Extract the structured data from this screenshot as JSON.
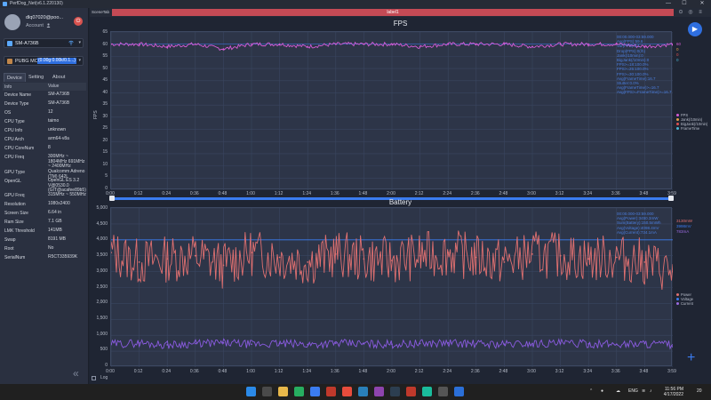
{
  "window": {
    "title": "PerfDog_Net(v6.1.220130)",
    "minimize": "—",
    "maximize": "☐",
    "close": "✕"
  },
  "account": {
    "name": "dlq07020@poo...",
    "sub": "Account",
    "sub_icon": "person-icon",
    "power": "⏻"
  },
  "device_select": {
    "label": "SM-A736B",
    "wifi": "wifi-icon",
    "chevron": "▾"
  },
  "app_select": {
    "label": "PUBG MOB...",
    "highlight": "(0.00g:0.00k/0.1...)",
    "chevron": "▾"
  },
  "tabs": [
    "Device",
    "Setting",
    "About"
  ],
  "info": {
    "header": {
      "key": "Info",
      "value": "Value"
    },
    "rows": [
      {
        "key": "Device Name",
        "value": "SM-A736B"
      },
      {
        "key": "Device Type",
        "value": "SM-A736B"
      },
      {
        "key": "OS",
        "value": "12"
      },
      {
        "key": "CPU Type",
        "value": "taimo"
      },
      {
        "key": "CPU Info",
        "value": "unknown"
      },
      {
        "key": "CPU Arch",
        "value": "arm64-v8a"
      },
      {
        "key": "CPU CoreNum",
        "value": "8"
      },
      {
        "key": "CPU Freq",
        "value": "300MHz ~ 1804MHz 691MHz ~ 2400MHz"
      },
      {
        "key": "GPU Type",
        "value": "Qualcomm Adreno (TM) 642L"
      },
      {
        "key": "OpenGL",
        "value": "OpenGL ES 3.2 V@0530.0 (GIT@acafee89b5)"
      },
      {
        "key": "GPU Freq",
        "value": "315MHz ~ 550MHz"
      },
      {
        "key": "Resolution",
        "value": "1080x2400"
      },
      {
        "key": "Screen Size",
        "value": "6.64 in"
      },
      {
        "key": "Ram Size",
        "value": "7.1 GB"
      },
      {
        "key": "LMK Threshold",
        "value": "141MB"
      },
      {
        "key": "Swap",
        "value": "8191 MB"
      },
      {
        "key": "Root",
        "value": "No"
      },
      {
        "key": "SerialNum",
        "value": "R5CT335939K"
      }
    ]
  },
  "scene": {
    "tab": "SceneTab",
    "label": "label1"
  },
  "fps_chart": {
    "title": "FPS",
    "ylabel": "FPS",
    "yticks": [
      "65",
      "60",
      "55",
      "50",
      "45",
      "40",
      "35",
      "30",
      "25",
      "20",
      "15",
      "10",
      "5",
      "0"
    ],
    "xticks": [
      "0:00",
      "0:12",
      "0:24",
      "0:36",
      "0:48",
      "1:00",
      "1:12",
      "1:24",
      "1:36",
      "1:48",
      "2:00",
      "2:12",
      "2:24",
      "2:36",
      "2:48",
      "3:00",
      "3:12",
      "3:24",
      "3:36",
      "3:48",
      "3:59"
    ],
    "stats": [
      "00:00.000-03:59.000",
      "Avg(FPS):59.6",
      "Var(FPS):0.1",
      "Drop(FPS):0(/h)",
      "Jank(/10min):0",
      "BigJank(/10min):0",
      "FPS>=18:100.0%",
      "FPS>=25:100.0%",
      "FPS>=30:100.0%",
      "Avg(FrameTime):16.7",
      "Stutter:0.0%",
      "Avg(FrameTime)>=16.7",
      "Avg(FPS>=FrameTime)>=16.7"
    ],
    "right_values": [
      "60",
      "0",
      "0",
      "0"
    ],
    "legend": [
      {
        "label": "FPS",
        "color": "#d65bd6"
      },
      {
        "label": "Jank(/10min)",
        "color": "#e0a04a"
      },
      {
        "label": "BigJank(/10min)",
        "color": "#e05050"
      },
      {
        "label": "FrameTime",
        "color": "#4bb8d6"
      }
    ]
  },
  "battery_chart": {
    "title": "Battery",
    "yticks": [
      "5,000",
      "4,500",
      "4,000",
      "3,500",
      "3,000",
      "2,500",
      "2,000",
      "1,500",
      "1,000",
      "500",
      "0"
    ],
    "xticks": [
      "0:00",
      "0:12",
      "0:24",
      "0:36",
      "0:48",
      "1:00",
      "1:12",
      "1:24",
      "1:36",
      "1:48",
      "2:00",
      "2:12",
      "2:24",
      "2:36",
      "2:48",
      "3:00",
      "3:12",
      "3:24",
      "3:36",
      "3:48",
      "3:59"
    ],
    "stats": [
      "00:00.000-03:59.000",
      "Avg(Power):3450.3mW",
      "Sum(Battery):150.5mWh",
      "Avg(Voltage):4098.4mV",
      "Avg(Current):734.1mA"
    ],
    "right_values": [
      "3130mW",
      "3998mV",
      "783mA"
    ],
    "legend": [
      {
        "label": "Power",
        "color": "#e07070"
      },
      {
        "label": "Voltage",
        "color": "#3b7cf0"
      },
      {
        "label": "Current",
        "color": "#9b6be0"
      }
    ]
  },
  "log": {
    "label": "Log"
  },
  "taskbar": {
    "lang": "ENG",
    "time": "11:56 PM",
    "date": "4/17/2022",
    "notify": "20"
  },
  "chart_data": [
    {
      "type": "line",
      "title": "FPS",
      "xlabel": "",
      "ylabel": "FPS",
      "ylim": [
        0,
        65
      ],
      "x": [
        "0:00",
        "0:12",
        "0:24",
        "0:36",
        "0:48",
        "1:00",
        "1:12",
        "1:24",
        "1:36",
        "1:48",
        "2:00",
        "2:12",
        "2:24",
        "2:36",
        "2:48",
        "3:00",
        "3:12",
        "3:24",
        "3:36",
        "3:48",
        "3:59"
      ],
      "series": [
        {
          "name": "FPS",
          "values": [
            60,
            60,
            59,
            60,
            58,
            60,
            60,
            59,
            60,
            60,
            60,
            59,
            60,
            60,
            60,
            59,
            60,
            60,
            60,
            59,
            60
          ]
        }
      ]
    },
    {
      "type": "line",
      "title": "Battery",
      "xlabel": "",
      "ylabel": "",
      "ylim": [
        0,
        5000
      ],
      "x": [
        "0:00",
        "0:12",
        "0:24",
        "0:36",
        "0:48",
        "1:00",
        "1:12",
        "1:24",
        "1:36",
        "1:48",
        "2:00",
        "2:12",
        "2:24",
        "2:36",
        "2:48",
        "3:00",
        "3:12",
        "3:24",
        "3:36",
        "3:48",
        "3:59"
      ],
      "series": [
        {
          "name": "Power",
          "values": [
            3600,
            3300,
            3400,
            3500,
            3200,
            3600,
            3450,
            3300,
            3550,
            3400,
            3350,
            3500,
            3600,
            3450,
            3300,
            3550,
            3500,
            3400,
            3450,
            3300,
            3000
          ]
        },
        {
          "name": "Current",
          "values": [
            720,
            760,
            700,
            740,
            760,
            720,
            740,
            710,
            750,
            730,
            720,
            740,
            760,
            730,
            720,
            740,
            750,
            730,
            720,
            740,
            700
          ]
        }
      ]
    }
  ]
}
